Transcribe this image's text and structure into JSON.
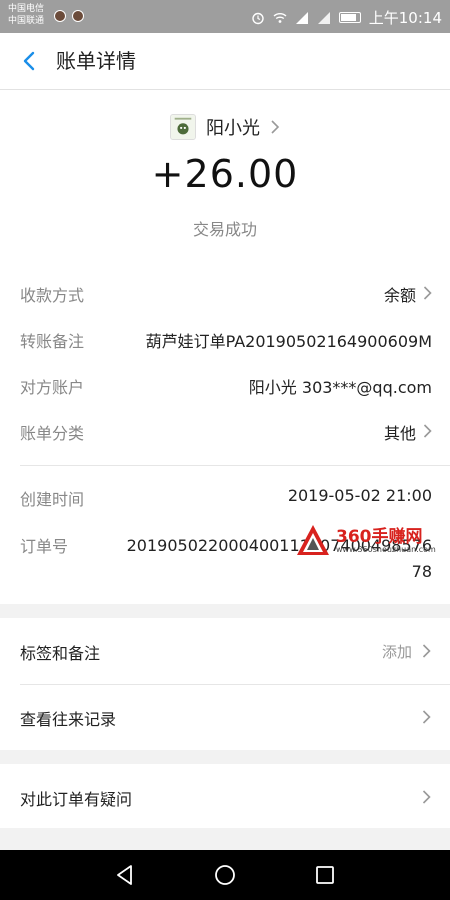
{
  "status_bar": {
    "carrier1": "中国电信",
    "carrier2": "中国联通",
    "time": "上午10:14"
  },
  "header": {
    "title": "账单详情",
    "back_icon": "chevron-left-icon"
  },
  "payee": {
    "name": "阳小光",
    "amount": "+26.00",
    "status": "交易成功"
  },
  "details": [
    {
      "label": "收款方式",
      "value": "余额"
    },
    {
      "label": "转账备注",
      "value": "葫芦娃订单PA20190502164900609M"
    },
    {
      "label": "对方账户",
      "value": "阳小光 303***@qq.com"
    },
    {
      "label": "账单分类",
      "value": "其他"
    },
    {
      "label": "创建时间",
      "value": "2019-05-02 21:00"
    },
    {
      "label": "订单号",
      "value": "2019050220004001110074004985767 8"
    }
  ],
  "order_number": "201905022000400111007400498576 78",
  "menu": {
    "tags_label": "标签和备注",
    "tags_hint": "添加",
    "history_label": "查看往来记录",
    "question_label": "对此订单有疑问"
  },
  "watermark": {
    "text": "360手赚网",
    "url": "www.360shouzhuan.com"
  },
  "colors": {
    "accent": "#1a8ee8",
    "watermark_red": "#d8221e"
  }
}
